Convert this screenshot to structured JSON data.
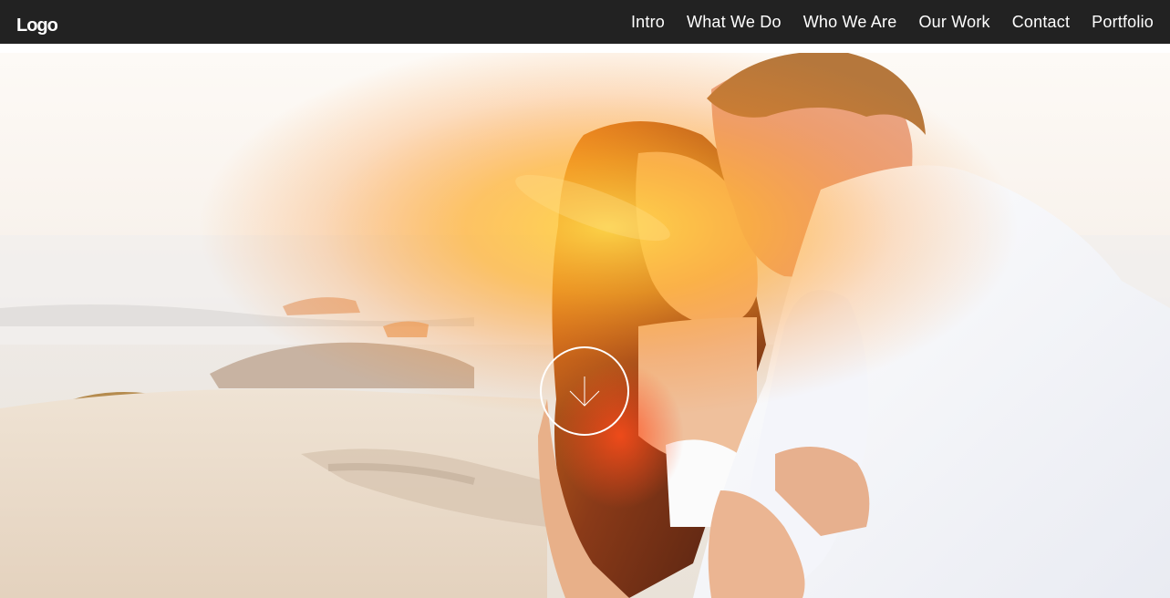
{
  "header": {
    "logo": "Logo",
    "nav": [
      {
        "label": "Intro"
      },
      {
        "label": "What We Do"
      },
      {
        "label": "Who We Are"
      },
      {
        "label": "Our Work"
      },
      {
        "label": "Contact"
      },
      {
        "label": "Portfolio"
      }
    ]
  },
  "hero": {
    "image": "beach-couple-photo",
    "scroll_icon": "arrow-down-icon"
  },
  "colors": {
    "navbar_bg": "#222222",
    "nav_text": "#ffffff"
  }
}
